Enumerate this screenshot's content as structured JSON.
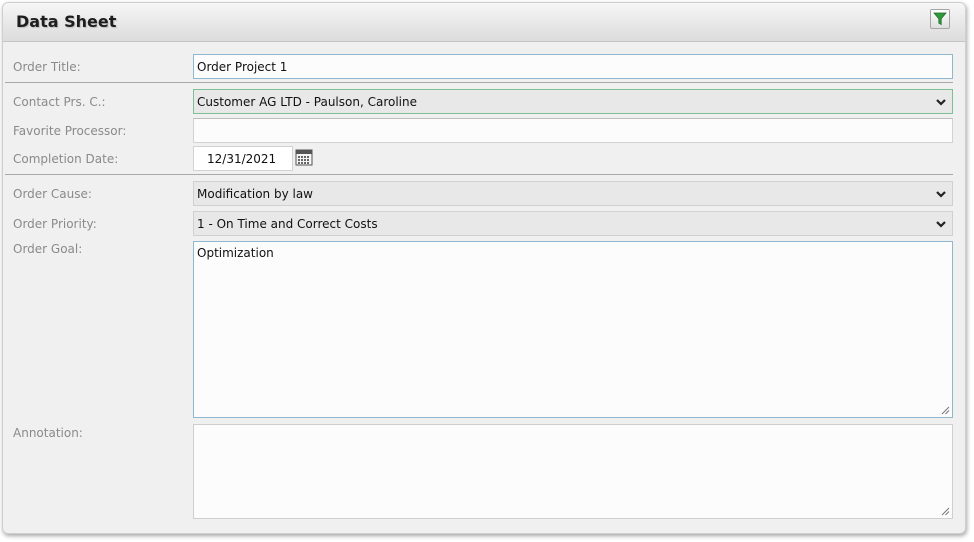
{
  "panel": {
    "title": "Data Sheet",
    "filter_icon": "filter-icon"
  },
  "form": {
    "order_title": {
      "label": "Order Title:",
      "value": "Order Project 1"
    },
    "contact_person": {
      "label": "Contact Prs. C.:",
      "value": "Customer AG LTD - Paulson, Caroline"
    },
    "favorite_processor": {
      "label": "Favorite Processor:",
      "value": ""
    },
    "completion_date": {
      "label": "Completion Date:",
      "value": "12/31/2021",
      "icon": "calendar-icon"
    },
    "order_cause": {
      "label": "Order Cause:",
      "value": "Modification by law"
    },
    "order_priority": {
      "label": "Order Priority:",
      "value": "1 - On Time and Correct Costs"
    },
    "order_goal": {
      "label": "Order Goal:",
      "value": "Optimization"
    },
    "annotation": {
      "label": "Annotation:",
      "value": ""
    }
  },
  "colors": {
    "panel_background": "#f0f0f0",
    "label_text": "#8a8a8a",
    "filter_icon": "#2f9a3a",
    "focused_select_border": "#7fbf95"
  }
}
